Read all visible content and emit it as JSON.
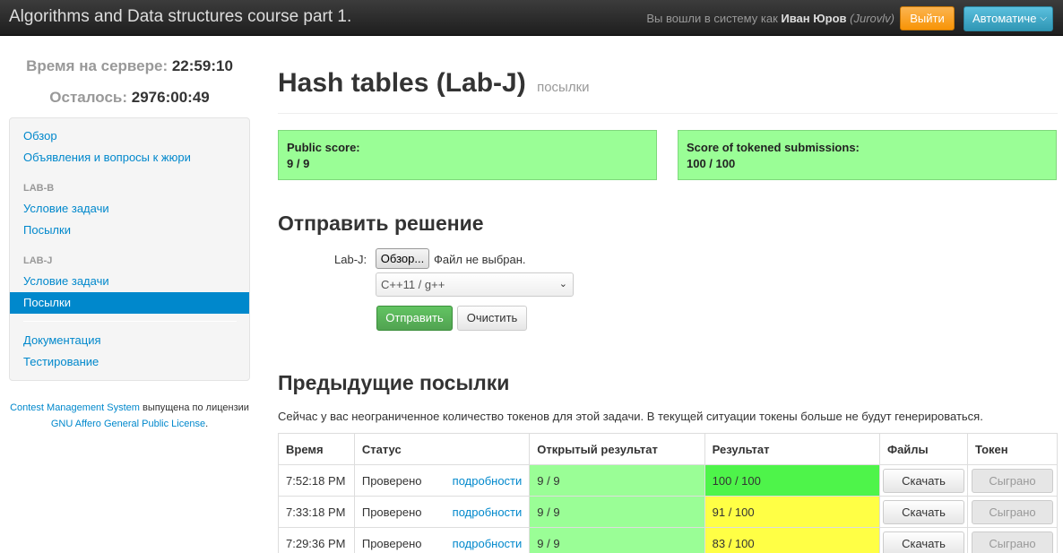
{
  "navbar": {
    "brand": "Algorithms and Data structures course part 1.",
    "logged_prefix": "Вы вошли в систему как",
    "user_name": "Иван Юров",
    "user_login": "(Jurovlv)",
    "logout_label": "Выйти",
    "language_label": "Автоматиче"
  },
  "sidebar": {
    "server_time_label": "Время на сервере:",
    "server_time_value": "22:59:10",
    "remaining_label": "Осталось:",
    "remaining_value": "2976:00:49",
    "items": {
      "overview": "Обзор",
      "announcements": "Объявления и вопросы к жюри",
      "lab_b_header": "LAB-B",
      "lab_b_statement": "Условие задачи",
      "lab_b_submissions": "Посылки",
      "lab_j_header": "LAB-J",
      "lab_j_statement": "Условие задачи",
      "lab_j_submissions": "Посылки",
      "documentation": "Документация",
      "testing": "Тестирование"
    },
    "footer": {
      "cms_link": "Contest Management System",
      "text1": "выпущена по лицензии",
      "license_link": "GNU Affero General Public License",
      "text2": "."
    }
  },
  "main": {
    "title": "Hash tables (Lab-J)",
    "subtitle": "посылки",
    "public_score_label": "Public score:",
    "public_score_value": "9 / 9",
    "tokened_score_label": "Score of tokened submissions:",
    "tokened_score_value": "100 / 100",
    "submit_heading": "Отправить решение",
    "file_label": "Lab-J:",
    "browse_label": "Обзор...",
    "file_status": "Файл не выбран.",
    "language_select": "C++11 / g++",
    "submit_label": "Отправить",
    "reset_label": "Очистить",
    "previous_heading": "Предыдущие посылки",
    "tokens_note": "Сейчас у вас неограниченное количество токенов для этой задачи. В текущей ситуации токены больше не будут генерироваться.",
    "table": {
      "headers": [
        "Время",
        "Статус",
        "Открытый результат",
        "Результат",
        "Файлы",
        "Токен"
      ],
      "rows": [
        {
          "time": "7:52:18 PM",
          "status": "Проверено",
          "details": "подробности",
          "public": "9 / 9",
          "result": "100 / 100",
          "download": "Скачать",
          "token": "Сыграно"
        },
        {
          "time": "7:33:18 PM",
          "status": "Проверено",
          "details": "подробности",
          "public": "9 / 9",
          "result": "91 / 100",
          "download": "Скачать",
          "token": "Сыграно"
        },
        {
          "time": "7:29:36 PM",
          "status": "Проверено",
          "details": "подробности",
          "public": "9 / 9",
          "result": "83 / 100",
          "download": "Скачать",
          "token": "Сыграно"
        }
      ]
    }
  },
  "colors": {
    "navbar": "#2c2c2c",
    "link": "#0088cc",
    "score_green": "#9afe96",
    "result_full": "#4ef44a",
    "result_partial": "#ffff45",
    "logout_orange": "#f89406",
    "language_blue": "#2f96b4"
  }
}
